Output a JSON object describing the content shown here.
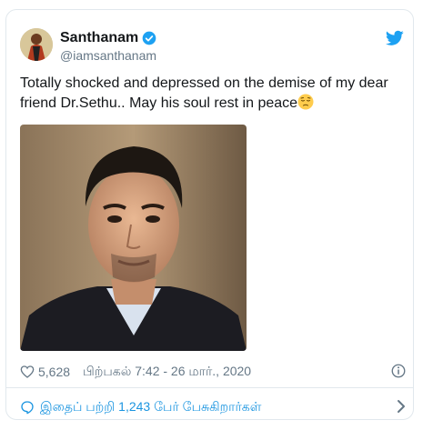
{
  "tweet": {
    "author_name": "Santhanam",
    "handle": "@iamsanthanam",
    "text": "Totally shocked and depressed on the demise of my dear friend Dr.Sethu.. May his soul rest in peace",
    "likes": "5,628",
    "timestamp": "பிற்பகல் 7:42 - 26 மார்., 2020",
    "conversation": "இதைப் பற்றி 1,243 பேர் பேசுகிறார்கள்"
  },
  "icons": {
    "verified": "verified-badge-icon",
    "bird": "twitter-bird-icon",
    "emoji": "pensive-face-emoji",
    "heart": "heart-icon",
    "info": "info-icon",
    "bubble": "speech-bubble-icon",
    "chevron": "chevron-right-icon"
  },
  "colors": {
    "twitter_blue": "#1da1f2",
    "link_blue": "#1b95e0",
    "muted": "#657786",
    "border": "#e1e8ed"
  }
}
